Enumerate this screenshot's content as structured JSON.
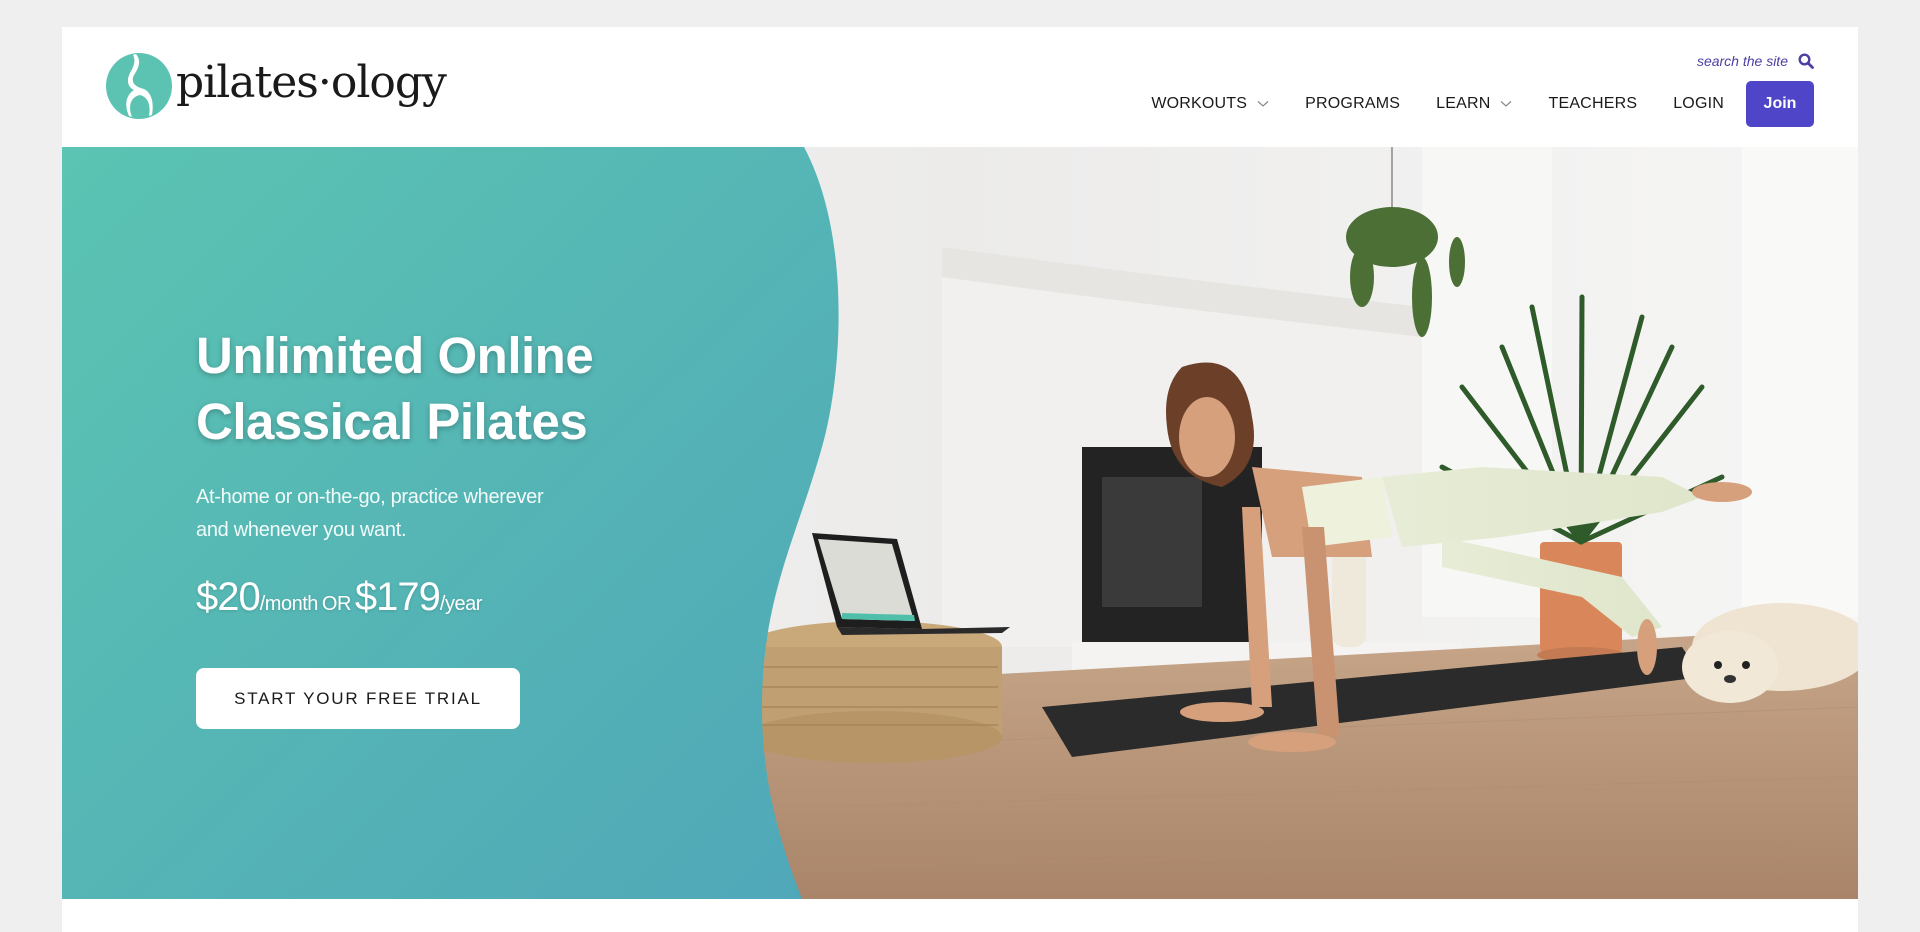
{
  "header": {
    "logo_text": "pilates·ology",
    "search_label": "search the site",
    "nav": [
      {
        "label": "WORKOUTS",
        "has_dropdown": true
      },
      {
        "label": "PROGRAMS",
        "has_dropdown": false
      },
      {
        "label": "LEARN",
        "has_dropdown": true
      },
      {
        "label": "TEACHERS",
        "has_dropdown": false
      },
      {
        "label": "LOGIN",
        "has_dropdown": false
      }
    ],
    "join_label": "Join"
  },
  "hero": {
    "headline_line1": "Unlimited Online",
    "headline_line2": "Classical Pilates",
    "subhead_line1": "At-home or on-the-go, practice wherever",
    "subhead_line2": "and whenever you want.",
    "price_monthly": "$20",
    "price_monthly_unit": "/month",
    "price_or": "OR",
    "price_yearly": "$179",
    "price_yearly_unit": "/year",
    "cta_label": "START YOUR FREE TRIAL",
    "image_alt": "Woman doing a plank leg lift on a black mat in a bright living room, laptop on a jute pouf, dog lying nearby"
  },
  "colors": {
    "brand_teal": "#5cc3b3",
    "teal_dark": "#4ea8b8",
    "join_purple": "#4f45c8",
    "search_purple": "#4b3fa3"
  }
}
